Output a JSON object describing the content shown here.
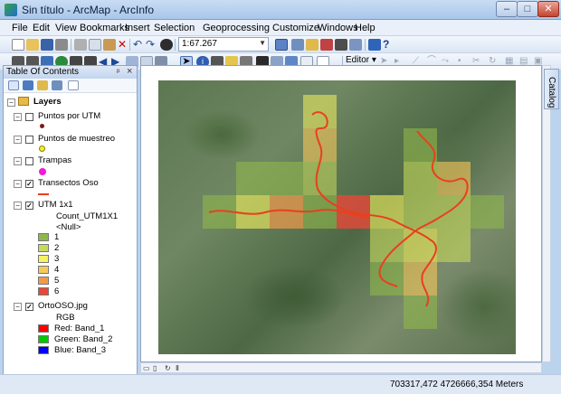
{
  "window": {
    "title": "Sin título - ArcMap - ArcInfo",
    "minimize": "–",
    "maximize": "□",
    "close": "✕"
  },
  "menu": [
    "File",
    "Edit",
    "View",
    "Bookmarks",
    "Insert",
    "Selection",
    "Geoprocessing",
    "Customize",
    "Windows",
    "Help"
  ],
  "toolbar": {
    "scale": "1:67.267",
    "editor_label": "Editor ▾"
  },
  "toc": {
    "title": "Table Of Contents",
    "pin": "ᵖ",
    "close": "×",
    "root": "Layers",
    "layers": [
      {
        "name": "Puntos por UTM",
        "checked": false,
        "symbol": "dot-darkred"
      },
      {
        "name": "Puntos de muestreo",
        "checked": false,
        "symbol": "circle-yellow"
      },
      {
        "name": "Trampas",
        "checked": false,
        "symbol": "circle-magenta"
      },
      {
        "name": "Transectos Oso",
        "checked": true,
        "symbol": "line-red"
      },
      {
        "name": "UTM 1x1",
        "checked": true,
        "field": "Count_UTM1X1",
        "null_label": "<Null>",
        "classes": [
          {
            "label": "1",
            "color": "#8fb84b"
          },
          {
            "label": "2",
            "color": "#c6db5b"
          },
          {
            "label": "3",
            "color": "#f5f35e"
          },
          {
            "label": "4",
            "color": "#f7c85a"
          },
          {
            "label": "5",
            "color": "#f29a4b"
          },
          {
            "label": "6",
            "color": "#e8473a"
          }
        ]
      },
      {
        "name": "OrtoOSO.jpg",
        "checked": true,
        "render": "RGB",
        "bands": [
          {
            "label": "Red:  Band_1",
            "color": "#ff0000"
          },
          {
            "label": "Green: Band_2",
            "color": "#00c800"
          },
          {
            "label": "Blue:  Band_3",
            "color": "#0000ff"
          }
        ]
      }
    ]
  },
  "catalog_tab": "Catalog",
  "status": {
    "coordinates": "703317,472  4726666,354 Meters"
  }
}
